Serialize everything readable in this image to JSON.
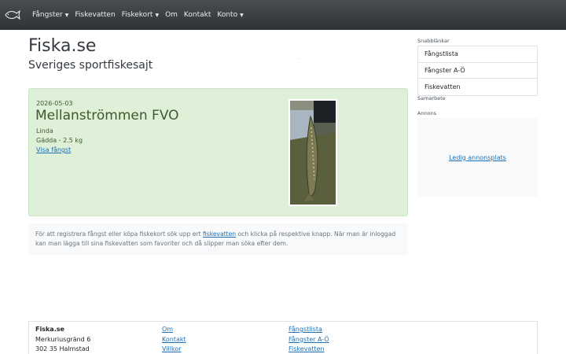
{
  "navbar": {
    "items": [
      {
        "label": "Fångster",
        "dropdown": true
      },
      {
        "label": "Fiskevatten",
        "dropdown": false
      },
      {
        "label": "Fiskekort",
        "dropdown": true
      },
      {
        "label": "Om",
        "dropdown": false
      },
      {
        "label": "Kontakt",
        "dropdown": false
      },
      {
        "label": "Konto",
        "dropdown": true
      }
    ],
    "brand_icon": "fish-logo-icon"
  },
  "header": {
    "title": "Fiska.se",
    "subtitle": "Sveriges sportfiskesajt"
  },
  "catch": {
    "date": "2026-05-03",
    "water": "Mellanströmmen FVO",
    "angler": "Linda",
    "fish": "Gädda - 2.5 kg",
    "link": "Visa fångst"
  },
  "info": {
    "text_before": "För att registrera fångst eller köpa fiskekort sök upp ert ",
    "link": "fiskevatten",
    "text_after": " och klicka på respektive knapp. När man är inloggad kan man lägga till sina fiskevatten som favoriter och då slipper man söka efter dem."
  },
  "sidebar": {
    "quick_title": "Snabblänkar",
    "quick_links": [
      "Fångstlista",
      "Fångster A-Ö",
      "Fiskevatten"
    ],
    "partner_title": "Samarbete",
    "ad_title": "Annons",
    "ad_link": "Ledig annonsplats"
  },
  "footer": {
    "col1": [
      "Fiska.se",
      "Merkuriusgränd 6",
      "302 35 Halmstad"
    ],
    "col2": [
      "Om",
      "Kontakt",
      "Villkor"
    ],
    "col3": [
      "Fångstlista",
      "Fångster A-Ö",
      "Fiskevatten"
    ]
  }
}
